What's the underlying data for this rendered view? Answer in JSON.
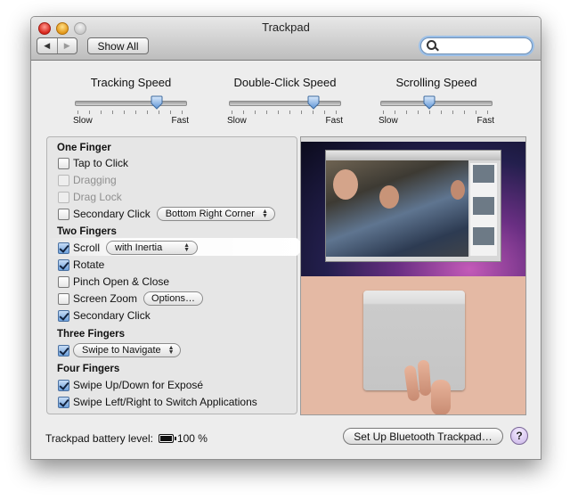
{
  "window": {
    "title": "Trackpad",
    "toolbar": {
      "back_icon": "triangle-left",
      "forward_icon": "triangle-right",
      "show_all_label": "Show All",
      "search_placeholder": "",
      "search_value": ""
    }
  },
  "sliders": [
    {
      "title": "Tracking Speed",
      "min_label": "Slow",
      "max_label": "Fast",
      "value": 0.75,
      "ticks": 10
    },
    {
      "title": "Double-Click Speed",
      "min_label": "Slow",
      "max_label": "Fast",
      "value": 0.78,
      "ticks": 10
    },
    {
      "title": "Scrolling Speed",
      "min_label": "Slow",
      "max_label": "Fast",
      "value": 0.44,
      "ticks": 10
    }
  ],
  "gestures": {
    "one_finger": {
      "heading": "One Finger",
      "tap_to_click": {
        "label": "Tap to Click",
        "checked": false,
        "enabled": true
      },
      "dragging": {
        "label": "Dragging",
        "checked": false,
        "enabled": false
      },
      "drag_lock": {
        "label": "Drag Lock",
        "checked": false,
        "enabled": false
      },
      "secondary_click": {
        "label": "Secondary Click",
        "checked": false,
        "enabled": true,
        "popup_value": "Bottom Right Corner"
      }
    },
    "two_fingers": {
      "heading": "Two Fingers",
      "scroll": {
        "label": "Scroll",
        "checked": true,
        "popup_value": "with Inertia",
        "selected": true
      },
      "rotate": {
        "label": "Rotate",
        "checked": true
      },
      "pinch": {
        "label": "Pinch Open & Close",
        "checked": false
      },
      "screen_zoom": {
        "label": "Screen Zoom",
        "checked": false,
        "button_label": "Options…"
      },
      "secondary_click": {
        "label": "Secondary Click",
        "checked": true
      }
    },
    "three_fingers": {
      "heading": "Three Fingers",
      "swipe": {
        "checked": true,
        "popup_value": "Swipe to Navigate"
      }
    },
    "four_fingers": {
      "heading": "Four Fingers",
      "expose": {
        "label": "Swipe Up/Down for Exposé",
        "checked": true
      },
      "switch_apps": {
        "label": "Swipe Left/Right to Switch Applications",
        "checked": true
      }
    }
  },
  "footer": {
    "battery_label": "Trackpad battery level:",
    "battery_icon": "battery-full",
    "battery_value": "100 %",
    "setup_button_label": "Set Up Bluetooth Trackpad…",
    "help_label": "?"
  },
  "colors": {
    "window_bg": "#ededed",
    "accent": "#6ea1dc",
    "help_button": "#c8b3e6"
  }
}
